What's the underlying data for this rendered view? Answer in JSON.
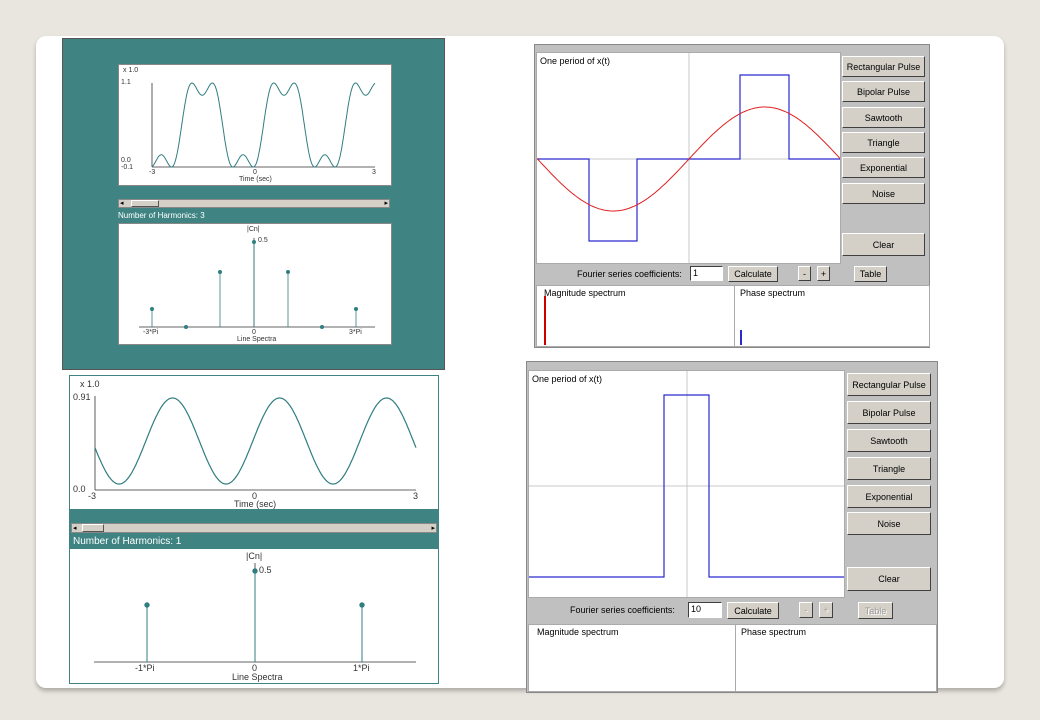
{
  "p1": {
    "scale": "x 1.0",
    "y_top": "1.1",
    "y_mid": "0.0",
    "y_bot": "-0.1",
    "x_left": "-3",
    "x_mid": "0",
    "x_right": "3",
    "xlabel": "Time (sec)",
    "harmonics_label": "Number of Harmonics: 3",
    "cn_label": "|Cn|",
    "cn_peak": "0.5",
    "spec_left": "-3*Pi",
    "spec_mid": "0",
    "spec_right": "3*Pi",
    "spec_xlabel": "Line Spectra"
  },
  "p2": {
    "scale": "x 1.0",
    "y_top": "0.91",
    "y_bot": "0.0",
    "x_left": "-3",
    "x_mid": "0",
    "x_right": "3",
    "xlabel": "Time (sec)",
    "harmonics_label": "Number of Harmonics: 1",
    "cn_label": "|Cn|",
    "cn_peak": "0.5",
    "spec_left": "-1*Pi",
    "spec_mid": "0",
    "spec_right": "1*Pi",
    "spec_xlabel": "Line Spectra"
  },
  "w1": {
    "plot_title": "One period of x(t)",
    "buttons": [
      "Rectangular Pulse",
      "Bipolar Pulse",
      "Sawtooth",
      "Triangle",
      "Exponential",
      "Noise"
    ],
    "clear": "Clear",
    "coef_label": "Fourier series coefficients:",
    "coef_value": "1",
    "calculate": "Calculate",
    "minus": "-",
    "plus": "+",
    "table": "Table",
    "magnitude": "Magnitude spectrum",
    "phase": "Phase spectrum"
  },
  "w2": {
    "plot_title": "One period of x(t)",
    "buttons": [
      "Rectangular Pulse",
      "Bipolar Pulse",
      "Sawtooth",
      "Triangle",
      "Exponential",
      "Noise"
    ],
    "clear": "Clear",
    "coef_label": "Fourier series coefficients:",
    "coef_value": "10",
    "calculate": "Calculate",
    "minus": "-",
    "plus": "+",
    "table": "Table",
    "magnitude": "Magnitude spectrum",
    "phase": "Phase spectrum"
  },
  "colors": {
    "teal_panel": "#3f8483",
    "wave": "#2f7e80",
    "blue_signal": "#2a2ad0",
    "red_signal": "#e02020",
    "spectrum_red": "#cc0000"
  }
}
